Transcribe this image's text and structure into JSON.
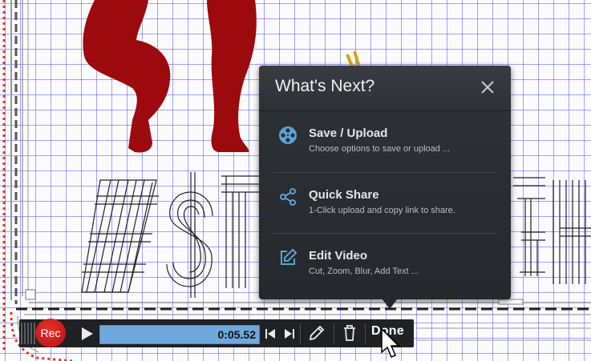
{
  "popup": {
    "title": "What's Next?",
    "options": [
      {
        "icon": "film-reel-icon",
        "title": "Save / Upload",
        "description": "Choose options to save or upload ..."
      },
      {
        "icon": "share-icon",
        "title": "Quick Share",
        "description": "1-Click upload and copy link to share."
      },
      {
        "icon": "edit-icon",
        "title": "Edit Video",
        "description": "Cut, Zoom, Blur, Add Text ..."
      }
    ]
  },
  "toolbar": {
    "rec_label": "Rec",
    "time": "0:05.52",
    "done_label": "Done",
    "progress_fraction": 1.0
  },
  "colors": {
    "accent_blue": "#5ba3d9",
    "progress": "#6fa8dc",
    "record": "#d61f1d",
    "panel": "#2a2d31",
    "figure": "#9c0a0d"
  }
}
